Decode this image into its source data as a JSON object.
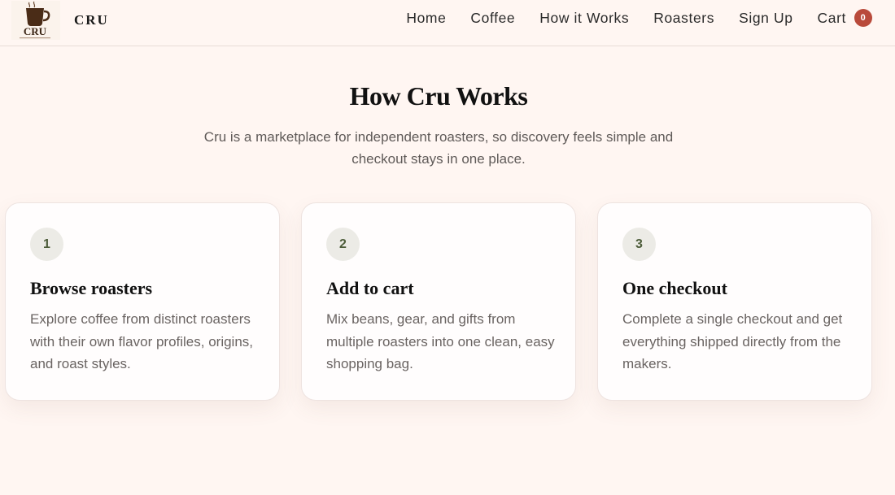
{
  "brand": {
    "logo_text": "CRU",
    "name": "CRU"
  },
  "nav": {
    "items": [
      {
        "label": "Home"
      },
      {
        "label": "Coffee"
      },
      {
        "label": "How it Works"
      },
      {
        "label": "Roasters"
      },
      {
        "label": "Sign Up"
      }
    ],
    "cart_label": "Cart",
    "cart_count": "0"
  },
  "section": {
    "title": "How Cru Works",
    "subtitle": "Cru is a marketplace for independent roasters, so discovery feels simple and checkout stays in one place."
  },
  "steps": [
    {
      "number": "1",
      "title": "Browse roasters",
      "text": "Explore coffee from distinct roasters with their own flavor profiles, origins, and roast styles."
    },
    {
      "number": "2",
      "title": "Add to cart",
      "text": "Mix beans, gear, and gifts from multiple roasters into one clean, easy shopping bag."
    },
    {
      "number": "3",
      "title": "One checkout",
      "text": "Complete a single checkout and get everything shipped directly from the makers."
    }
  ],
  "colors": {
    "background": "#fff6f2",
    "badge": "#b94a3b",
    "step_circle": "#ecebe6",
    "step_number": "#4d5d3a"
  }
}
